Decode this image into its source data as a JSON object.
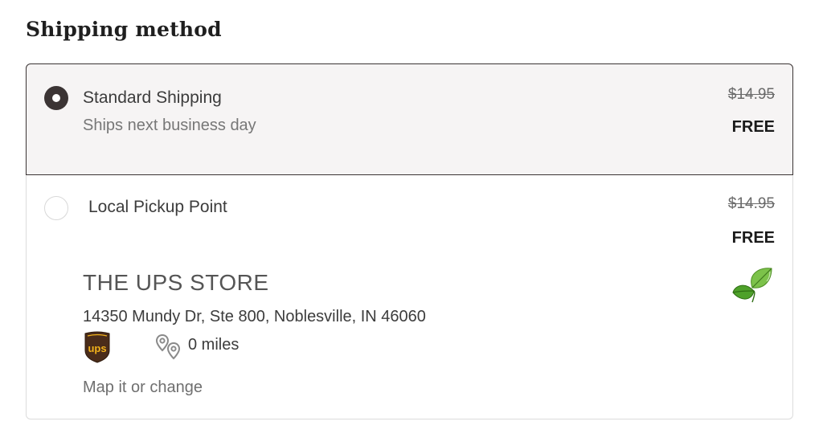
{
  "section": {
    "title": "Shipping method"
  },
  "options": [
    {
      "name": "Standard Shipping",
      "subtitle": "Ships next business day",
      "original_price": "$14.95",
      "price": "FREE",
      "selected": true
    },
    {
      "name": "Local Pickup Point",
      "original_price": "$14.95",
      "price": "FREE",
      "selected": false,
      "store": {
        "name": "THE UPS STORE",
        "address": "14350 Mundy Dr, Ste 800, Noblesville, IN 46060",
        "distance": "0 miles",
        "map_link": "Map it or change",
        "carrier_logo": "ups-logo",
        "distance_icon": "map-pin-icon",
        "eco_icon": "leaf-icon"
      }
    }
  ],
  "colors": {
    "selected_border": "#3a3434",
    "selected_background": "#f6f4f4",
    "radio_fill": "#3b3434",
    "ups_brown": "#4a2c1a",
    "ups_gold": "#f2b21b",
    "leaf_green": "#5cae2c"
  }
}
